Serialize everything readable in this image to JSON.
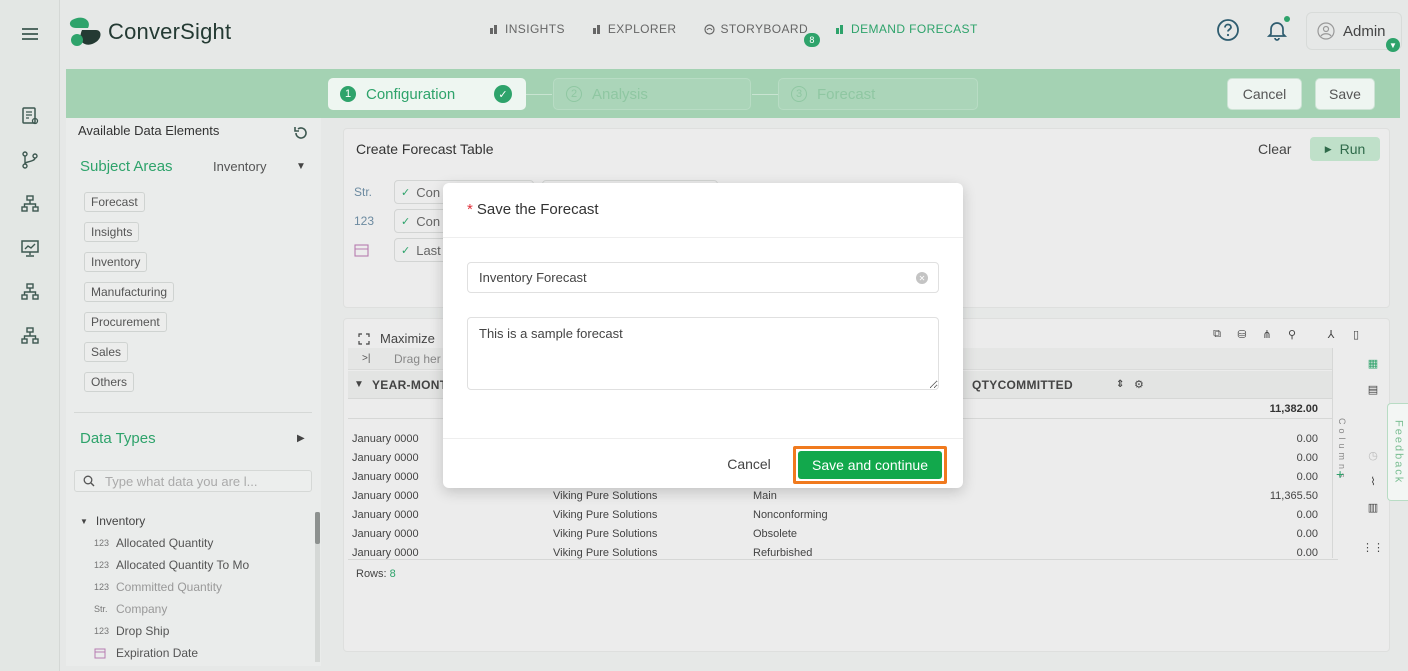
{
  "app": {
    "brand": "ConverSight"
  },
  "topnav": [
    {
      "label": "INSIGHTS"
    },
    {
      "label": "EXPLORER"
    },
    {
      "label": "STORYBOARD",
      "badge": "8"
    },
    {
      "label": "DEMAND FORECAST",
      "active": true
    }
  ],
  "user": {
    "name": "Admin"
  },
  "steps": [
    {
      "num": "1",
      "label": "Configuration",
      "state": "done"
    },
    {
      "num": "2",
      "label": "Analysis",
      "state": "todo"
    },
    {
      "num": "3",
      "label": "Forecast",
      "state": "todo"
    }
  ],
  "header_actions": {
    "cancel": "Cancel",
    "save": "Save"
  },
  "left_panel": {
    "title": "Available Data Elements",
    "subject_areas_label": "Subject Areas",
    "subject_area_value": "Inventory",
    "subject_chips": [
      "Forecast",
      "Insights",
      "Inventory",
      "Manufacturing",
      "Procurement",
      "Sales",
      "Others"
    ],
    "data_types_label": "Data Types",
    "search_placeholder": "Type what data you are l...",
    "tree_root": "Inventory",
    "tree_items": [
      {
        "type": "123",
        "label": "Allocated Quantity"
      },
      {
        "type": "123",
        "label": "Allocated Quantity To Mo"
      },
      {
        "type": "123",
        "label": "Committed Quantity",
        "dim": true
      },
      {
        "type": "Str.",
        "label": "Company",
        "dim": true
      },
      {
        "type": "123",
        "label": "Drop Ship"
      },
      {
        "type": "cal",
        "label": "Expiration Date"
      }
    ]
  },
  "create_table": {
    "title": "Create Forecast Table",
    "clear": "Clear",
    "run": "Run",
    "rows": [
      {
        "type": "Str.",
        "value": "Con"
      },
      {
        "type": "123",
        "value": "Con"
      },
      {
        "type": "cal",
        "value": "Last"
      }
    ]
  },
  "grid": {
    "maximize": "Maximize",
    "drag_placeholder": "Drag her",
    "columns": [
      "YEAR-MONT",
      "QTYCOMMITTED"
    ],
    "total": "11,382.00",
    "rows": [
      {
        "month": "January 0000",
        "company": "",
        "loc": "",
        "qty": "0.00"
      },
      {
        "month": "January 0000",
        "company": "",
        "loc": "",
        "qty": "0.00"
      },
      {
        "month": "January 0000",
        "company": "",
        "loc": "",
        "qty": "0.00"
      },
      {
        "month": "January 0000",
        "company": "Viking Pure Solutions",
        "loc": "Main",
        "qty": "11,365.50"
      },
      {
        "month": "January 0000",
        "company": "Viking Pure Solutions",
        "loc": "Nonconforming",
        "qty": "0.00"
      },
      {
        "month": "January 0000",
        "company": "Viking Pure Solutions",
        "loc": "Obsolete",
        "qty": "0.00"
      },
      {
        "month": "January 0000",
        "company": "Viking Pure Solutions",
        "loc": "Refurbished",
        "qty": "0.00"
      }
    ],
    "side_label": "Columns",
    "rows_label": "Rows:",
    "rows_count": "8"
  },
  "feedback": "Feedback",
  "modal": {
    "required_mark": "*",
    "title": "Save the Forecast",
    "name_value": "Inventory Forecast",
    "description_value": "This is a sample forecast",
    "cancel": "Cancel",
    "save_continue": "Save and continue"
  },
  "colors": {
    "accent": "#2ea36b",
    "save_button": "#12a84c",
    "highlight": "#f07a1e",
    "stepbar": "#a4d2b3"
  }
}
